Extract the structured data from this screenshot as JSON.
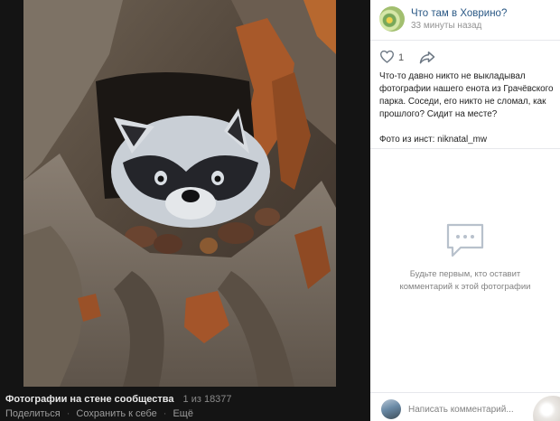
{
  "viewer": {
    "album_title": "Фотографии на стене сообщества",
    "counter": "1 из 18377",
    "actions": [
      "Поделиться",
      "Сохранить к себе",
      "Ещё"
    ]
  },
  "post": {
    "community_name": "Что там в Ховрино?",
    "time": "33 минуты назад",
    "likes": "1",
    "text": "Что-то давно никто не выкладывал фотографии нашего енота из Грачёвского парка. Соседи, его никто не сломал, как прошлого? Сидит на месте?",
    "credit": "Фото из инст: niknatal_mw"
  },
  "comments": {
    "empty_text": "Будьте первым, кто оставит комментарий к этой фотографии",
    "placeholder": "Написать комментарий..."
  },
  "colors": {
    "link": "#2a5885",
    "viewer_bg": "#141414",
    "panel_bg": "#ffffff"
  }
}
